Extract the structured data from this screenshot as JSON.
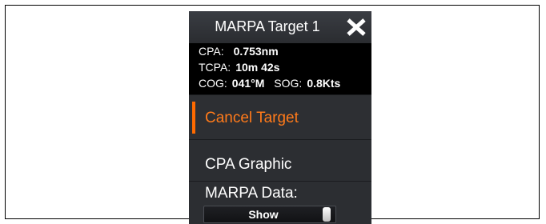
{
  "dialog": {
    "title": "MARPA Target 1",
    "close_icon": "close-icon"
  },
  "info": {
    "cpa": {
      "label": "CPA:",
      "value": "0.753nm"
    },
    "tcpa": {
      "label": "TCPA:",
      "value": "10m 42s"
    },
    "cog": {
      "label": "COG:",
      "value": "041°M"
    },
    "sog": {
      "label": "SOG:",
      "value": "0.8Kts"
    }
  },
  "menu": {
    "cancel_target": "Cancel Target",
    "cpa_graphic": "CPA Graphic",
    "marpa_data": "MARPA Data:",
    "marpa_data_value": "Show"
  },
  "colors": {
    "accent": "#ff6a00",
    "panel": "#2b2d31",
    "info_bg": "#000000"
  }
}
